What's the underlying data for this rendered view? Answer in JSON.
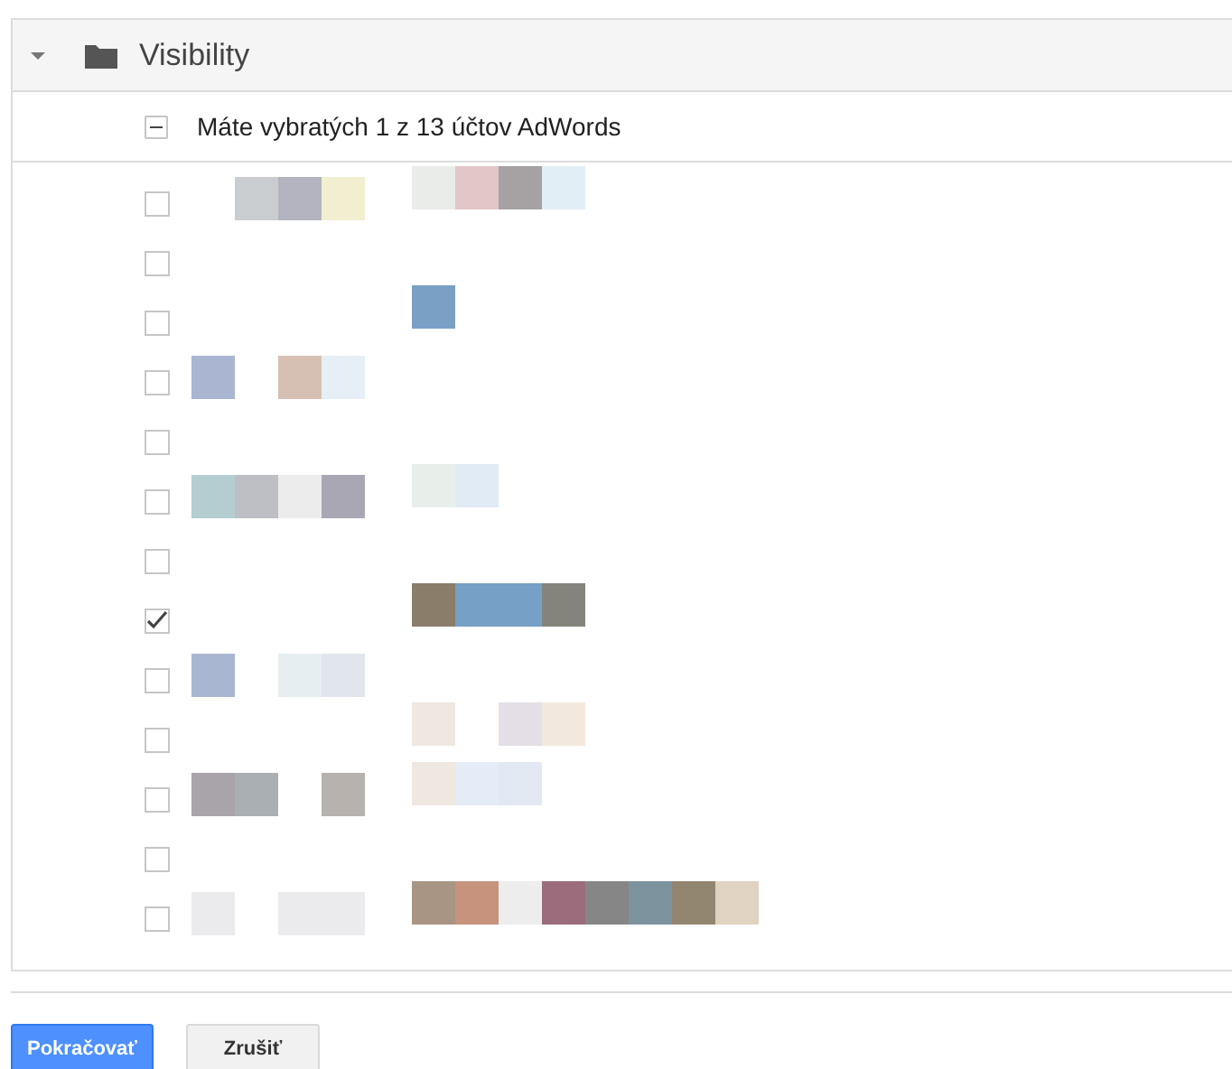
{
  "panel": {
    "title": "Visibility",
    "expanded": true
  },
  "summary": {
    "text": "Máte vybratých 1 z 13 účtov AdWords",
    "indeterminate": true
  },
  "accounts": [
    {
      "checked": false
    },
    {
      "checked": false
    },
    {
      "checked": false
    },
    {
      "checked": false
    },
    {
      "checked": false
    },
    {
      "checked": false
    },
    {
      "checked": false
    },
    {
      "checked": true
    },
    {
      "checked": false
    },
    {
      "checked": false
    },
    {
      "checked": false
    },
    {
      "checked": false
    },
    {
      "checked": false
    }
  ],
  "buttons": [
    {
      "label": "Pokračovať",
      "kind": "primary"
    },
    {
      "label": "Zrušiť",
      "kind": "secondary"
    }
  ]
}
